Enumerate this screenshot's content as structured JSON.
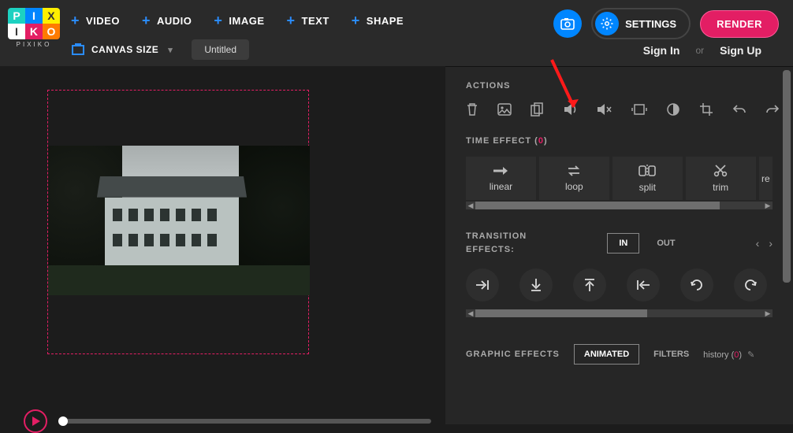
{
  "logo": {
    "sub": "PIXIKO",
    "cells": [
      "P",
      "I",
      "X",
      "I",
      "K",
      "O"
    ]
  },
  "menu": {
    "video": "VIDEO",
    "audio": "AUDIO",
    "image": "IMAGE",
    "text": "TEXT",
    "shape": "SHAPE",
    "canvas": "CANVAS SIZE",
    "title": "Untitled"
  },
  "header": {
    "settings": "SETTINGS",
    "render": "RENDER",
    "signin": "Sign In",
    "or": "or",
    "signup": "Sign Up"
  },
  "actions_title": "ACTIONS",
  "time_effect": {
    "label": "TIME EFFECT (",
    "count": "0",
    "close": ")"
  },
  "te": {
    "linear": "linear",
    "loop": "loop",
    "split": "split",
    "trim": "trim",
    "re": "re"
  },
  "transition": {
    "label1": "TRANSITION",
    "label2": "EFFECTS:",
    "in": "IN",
    "out": "OUT"
  },
  "graphic": {
    "title": "GRAPHIC EFFECTS",
    "animated": "ANIMATED",
    "filters": "FILTERS",
    "history": "history (",
    "hcount": "0",
    "hclose": ")"
  }
}
